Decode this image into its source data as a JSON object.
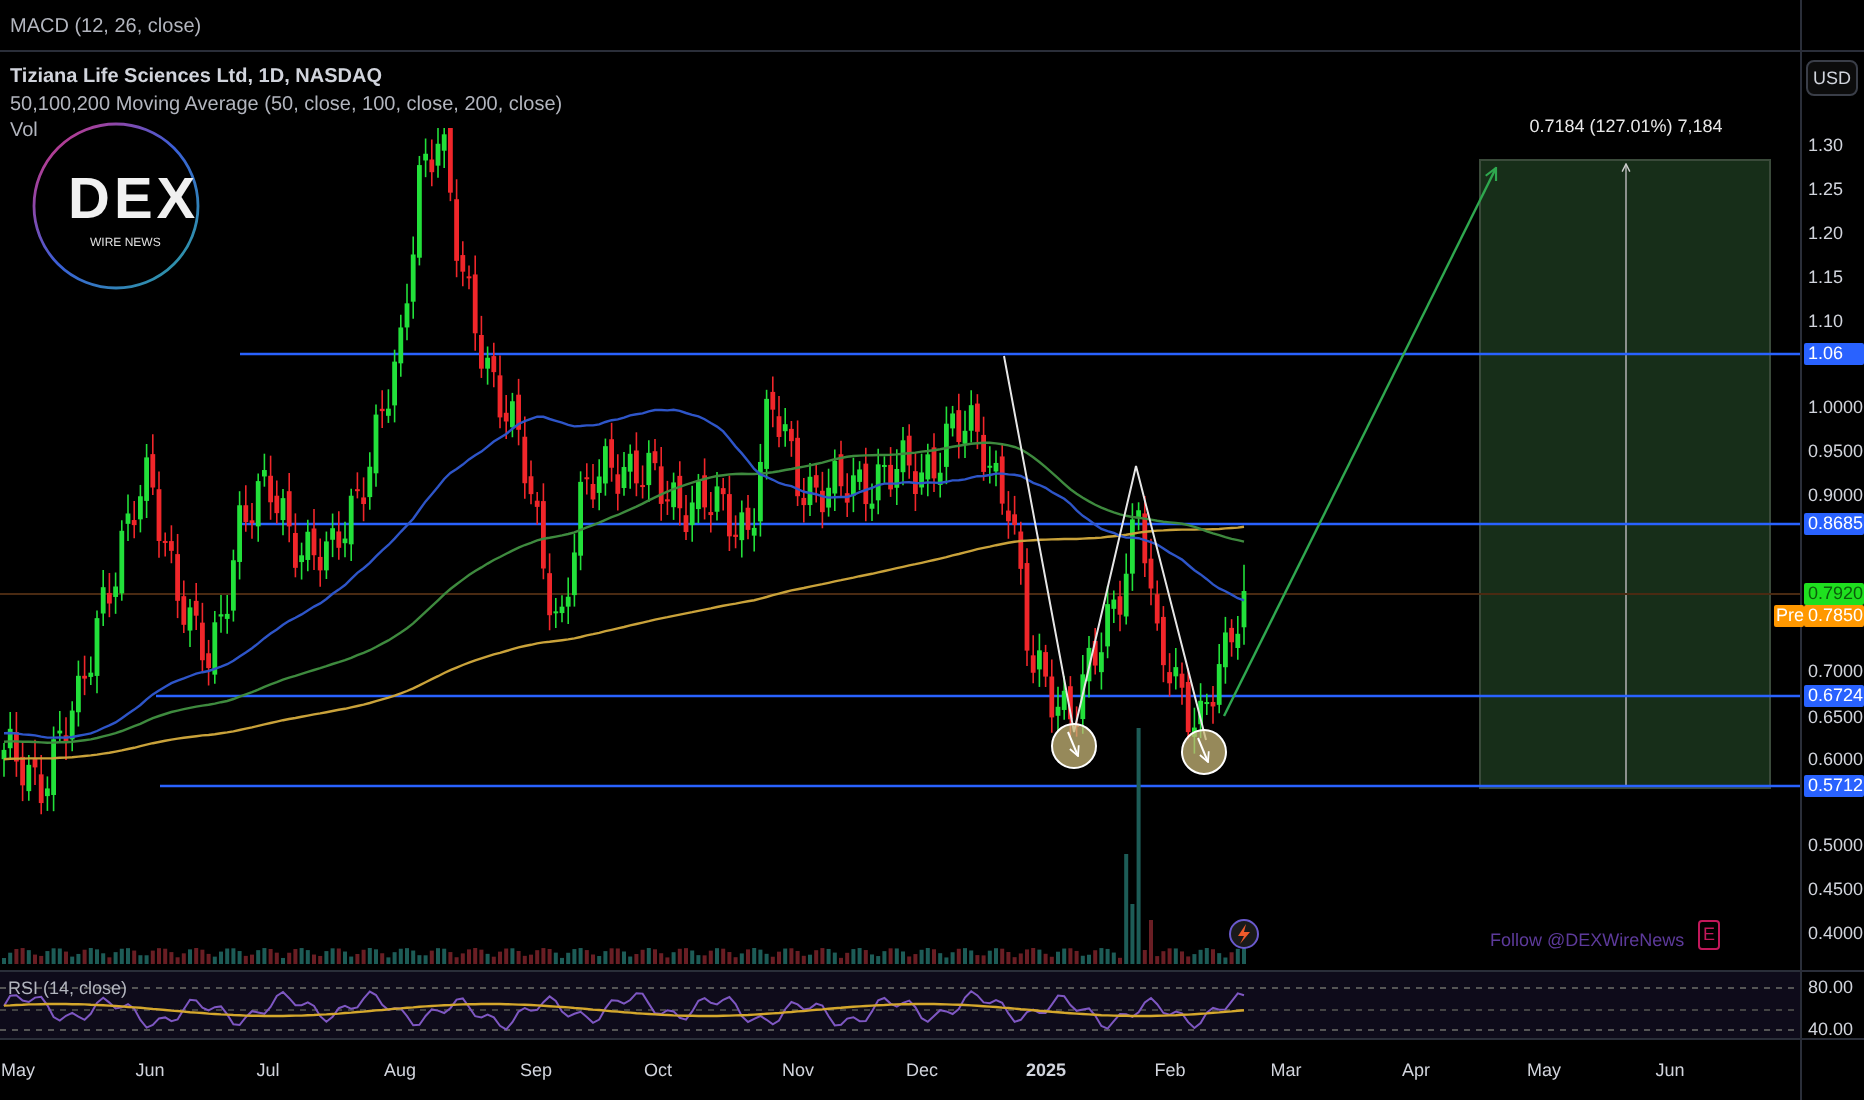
{
  "macd_pane": {
    "label": "MACD (12, 26, close)"
  },
  "currency_button": {
    "label": "USD"
  },
  "legend": {
    "symbol": "Tiziana Life Sciences Ltd, 1D, NASDAQ",
    "indicators": [
      "50,100,200 Moving Average (50, close, 100, close, 200, close)",
      "Vol"
    ]
  },
  "logo": {
    "title": "DEX",
    "subtitle": "WIRE NEWS"
  },
  "price_axis": {
    "ticks": [
      "1.30",
      "1.25",
      "1.20",
      "1.15",
      "1.10",
      "1.0000",
      "0.9500",
      "0.9000",
      "0.7000",
      "0.6500",
      "0.6000",
      "0.5000",
      "0.4500",
      "0.4000"
    ]
  },
  "price_tags": [
    {
      "label": "1.06",
      "kind": "level"
    },
    {
      "label": "0.8685",
      "kind": "level"
    },
    {
      "label": "0.7920",
      "kind": "last"
    },
    {
      "label": "0.7850",
      "kind": "premarket",
      "prefix": "Pre"
    },
    {
      "label": "0.6724",
      "kind": "level"
    },
    {
      "label": "0.5712",
      "kind": "level"
    }
  ],
  "projection": {
    "label": "0.7184 (127.01%) 7,184"
  },
  "footer_note": "Follow @DEXWireNews",
  "earnings_badge": "E",
  "rsi_pane": {
    "label": "RSI (14, close)",
    "ticks": [
      "80.00",
      "40.00"
    ]
  },
  "time_axis": [
    "May",
    "Jun",
    "Jul",
    "Aug",
    "Sep",
    "Oct",
    "Nov",
    "Dec",
    "2025",
    "Feb",
    "Mar",
    "Apr",
    "May",
    "Jun"
  ]
}
